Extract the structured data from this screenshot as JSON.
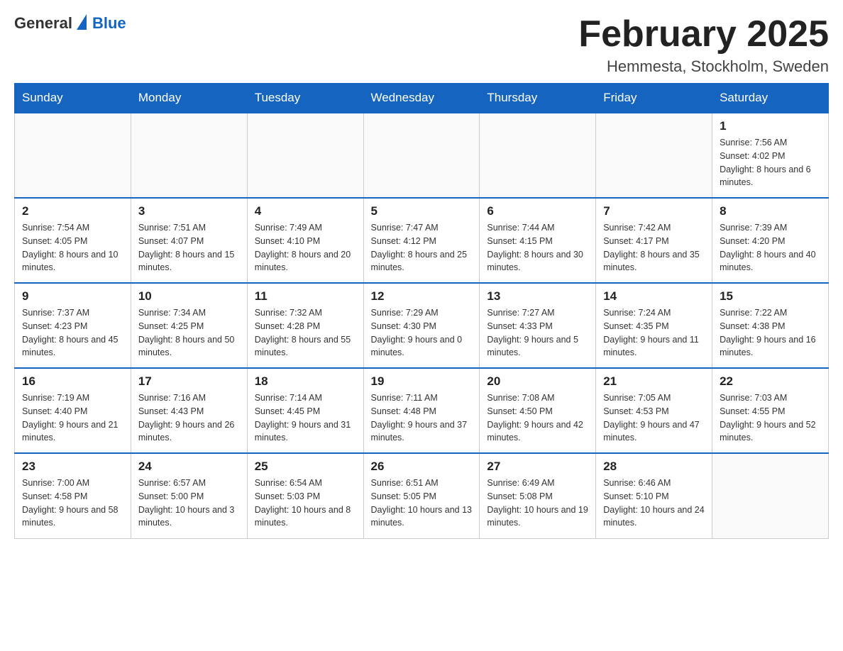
{
  "header": {
    "logo": {
      "general": "General",
      "blue": "Blue"
    },
    "title": "February 2025",
    "location": "Hemmesta, Stockholm, Sweden"
  },
  "days_of_week": [
    "Sunday",
    "Monday",
    "Tuesday",
    "Wednesday",
    "Thursday",
    "Friday",
    "Saturday"
  ],
  "weeks": [
    [
      {
        "day": "",
        "info": ""
      },
      {
        "day": "",
        "info": ""
      },
      {
        "day": "",
        "info": ""
      },
      {
        "day": "",
        "info": ""
      },
      {
        "day": "",
        "info": ""
      },
      {
        "day": "",
        "info": ""
      },
      {
        "day": "1",
        "sunrise": "Sunrise: 7:56 AM",
        "sunset": "Sunset: 4:02 PM",
        "daylight": "Daylight: 8 hours and 6 minutes."
      }
    ],
    [
      {
        "day": "2",
        "sunrise": "Sunrise: 7:54 AM",
        "sunset": "Sunset: 4:05 PM",
        "daylight": "Daylight: 8 hours and 10 minutes."
      },
      {
        "day": "3",
        "sunrise": "Sunrise: 7:51 AM",
        "sunset": "Sunset: 4:07 PM",
        "daylight": "Daylight: 8 hours and 15 minutes."
      },
      {
        "day": "4",
        "sunrise": "Sunrise: 7:49 AM",
        "sunset": "Sunset: 4:10 PM",
        "daylight": "Daylight: 8 hours and 20 minutes."
      },
      {
        "day": "5",
        "sunrise": "Sunrise: 7:47 AM",
        "sunset": "Sunset: 4:12 PM",
        "daylight": "Daylight: 8 hours and 25 minutes."
      },
      {
        "day": "6",
        "sunrise": "Sunrise: 7:44 AM",
        "sunset": "Sunset: 4:15 PM",
        "daylight": "Daylight: 8 hours and 30 minutes."
      },
      {
        "day": "7",
        "sunrise": "Sunrise: 7:42 AM",
        "sunset": "Sunset: 4:17 PM",
        "daylight": "Daylight: 8 hours and 35 minutes."
      },
      {
        "day": "8",
        "sunrise": "Sunrise: 7:39 AM",
        "sunset": "Sunset: 4:20 PM",
        "daylight": "Daylight: 8 hours and 40 minutes."
      }
    ],
    [
      {
        "day": "9",
        "sunrise": "Sunrise: 7:37 AM",
        "sunset": "Sunset: 4:23 PM",
        "daylight": "Daylight: 8 hours and 45 minutes."
      },
      {
        "day": "10",
        "sunrise": "Sunrise: 7:34 AM",
        "sunset": "Sunset: 4:25 PM",
        "daylight": "Daylight: 8 hours and 50 minutes."
      },
      {
        "day": "11",
        "sunrise": "Sunrise: 7:32 AM",
        "sunset": "Sunset: 4:28 PM",
        "daylight": "Daylight: 8 hours and 55 minutes."
      },
      {
        "day": "12",
        "sunrise": "Sunrise: 7:29 AM",
        "sunset": "Sunset: 4:30 PM",
        "daylight": "Daylight: 9 hours and 0 minutes."
      },
      {
        "day": "13",
        "sunrise": "Sunrise: 7:27 AM",
        "sunset": "Sunset: 4:33 PM",
        "daylight": "Daylight: 9 hours and 5 minutes."
      },
      {
        "day": "14",
        "sunrise": "Sunrise: 7:24 AM",
        "sunset": "Sunset: 4:35 PM",
        "daylight": "Daylight: 9 hours and 11 minutes."
      },
      {
        "day": "15",
        "sunrise": "Sunrise: 7:22 AM",
        "sunset": "Sunset: 4:38 PM",
        "daylight": "Daylight: 9 hours and 16 minutes."
      }
    ],
    [
      {
        "day": "16",
        "sunrise": "Sunrise: 7:19 AM",
        "sunset": "Sunset: 4:40 PM",
        "daylight": "Daylight: 9 hours and 21 minutes."
      },
      {
        "day": "17",
        "sunrise": "Sunrise: 7:16 AM",
        "sunset": "Sunset: 4:43 PM",
        "daylight": "Daylight: 9 hours and 26 minutes."
      },
      {
        "day": "18",
        "sunrise": "Sunrise: 7:14 AM",
        "sunset": "Sunset: 4:45 PM",
        "daylight": "Daylight: 9 hours and 31 minutes."
      },
      {
        "day": "19",
        "sunrise": "Sunrise: 7:11 AM",
        "sunset": "Sunset: 4:48 PM",
        "daylight": "Daylight: 9 hours and 37 minutes."
      },
      {
        "day": "20",
        "sunrise": "Sunrise: 7:08 AM",
        "sunset": "Sunset: 4:50 PM",
        "daylight": "Daylight: 9 hours and 42 minutes."
      },
      {
        "day": "21",
        "sunrise": "Sunrise: 7:05 AM",
        "sunset": "Sunset: 4:53 PM",
        "daylight": "Daylight: 9 hours and 47 minutes."
      },
      {
        "day": "22",
        "sunrise": "Sunrise: 7:03 AM",
        "sunset": "Sunset: 4:55 PM",
        "daylight": "Daylight: 9 hours and 52 minutes."
      }
    ],
    [
      {
        "day": "23",
        "sunrise": "Sunrise: 7:00 AM",
        "sunset": "Sunset: 4:58 PM",
        "daylight": "Daylight: 9 hours and 58 minutes."
      },
      {
        "day": "24",
        "sunrise": "Sunrise: 6:57 AM",
        "sunset": "Sunset: 5:00 PM",
        "daylight": "Daylight: 10 hours and 3 minutes."
      },
      {
        "day": "25",
        "sunrise": "Sunrise: 6:54 AM",
        "sunset": "Sunset: 5:03 PM",
        "daylight": "Daylight: 10 hours and 8 minutes."
      },
      {
        "day": "26",
        "sunrise": "Sunrise: 6:51 AM",
        "sunset": "Sunset: 5:05 PM",
        "daylight": "Daylight: 10 hours and 13 minutes."
      },
      {
        "day": "27",
        "sunrise": "Sunrise: 6:49 AM",
        "sunset": "Sunset: 5:08 PM",
        "daylight": "Daylight: 10 hours and 19 minutes."
      },
      {
        "day": "28",
        "sunrise": "Sunrise: 6:46 AM",
        "sunset": "Sunset: 5:10 PM",
        "daylight": "Daylight: 10 hours and 24 minutes."
      },
      {
        "day": "",
        "info": ""
      }
    ]
  ]
}
